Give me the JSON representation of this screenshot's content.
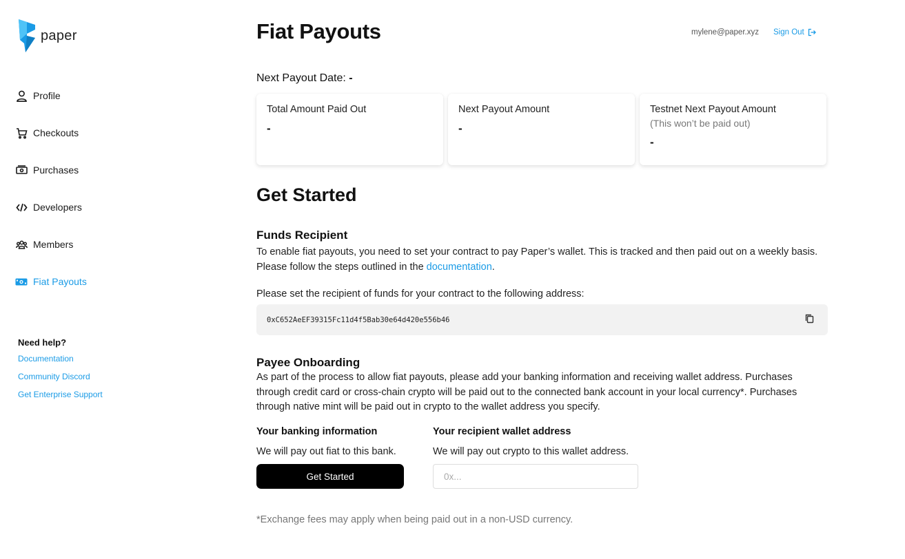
{
  "brand": {
    "name": "paper",
    "accent": "#1a9be6"
  },
  "sidebar": {
    "items": [
      {
        "label": "Profile",
        "icon": "user-icon",
        "active": false
      },
      {
        "label": "Checkouts",
        "icon": "cart-icon",
        "active": false
      },
      {
        "label": "Purchases",
        "icon": "cash-icon",
        "active": false
      },
      {
        "label": "Developers",
        "icon": "code-icon",
        "active": false
      },
      {
        "label": "Members",
        "icon": "users-icon",
        "active": false
      },
      {
        "label": "Fiat Payouts",
        "icon": "money-icon",
        "active": true
      }
    ],
    "help": {
      "title": "Need help?",
      "links": [
        "Documentation",
        "Community Discord",
        "Get Enterprise Support"
      ]
    }
  },
  "header": {
    "title": "Fiat Payouts",
    "user_email": "mylene@paper.xyz",
    "signout_label": "Sign Out"
  },
  "payout": {
    "next_date_label": "Next Payout Date:",
    "next_date_value": "-",
    "cards": [
      {
        "title": "Total Amount Paid Out",
        "subtitle": "",
        "value": "-"
      },
      {
        "title": "Next Payout Amount",
        "subtitle": "",
        "value": "-"
      },
      {
        "title": "Testnet Next Payout Amount",
        "subtitle": "(This won’t be paid out)",
        "value": "-"
      }
    ]
  },
  "get_started": {
    "title": "Get Started",
    "funds": {
      "title": "Funds Recipient",
      "desc_before": "To enable fiat payouts, you need to set your contract to pay Paper’s wallet. This is tracked and then paid out on a weekly basis. Please follow the steps outlined in the ",
      "desc_link": "documentation",
      "desc_after": ".",
      "address_prompt": "Please set the recipient of funds for your contract to the following address:",
      "address": "0xC652AeEF39315Fc11d4f5Bab30e64d420e556b46"
    },
    "payee": {
      "title": "Payee Onboarding",
      "desc": "As part of the process to allow fiat payouts, please add your banking information and receiving wallet address. Purchases through credit card or cross-chain crypto will be paid out to the connected bank account in your local currency*. Purchases through native mint will be paid out in crypto to the wallet address you specify.",
      "bank_title": "Your banking information",
      "bank_desc": "We will pay out fiat to this bank.",
      "bank_button": "Get Started",
      "wallet_title": "Your recipient wallet address",
      "wallet_desc": "We will pay out crypto to this wallet address.",
      "wallet_placeholder": "0x...",
      "wallet_value": ""
    },
    "footnote": "*Exchange fees may apply when being paid out in a non-USD currency."
  }
}
